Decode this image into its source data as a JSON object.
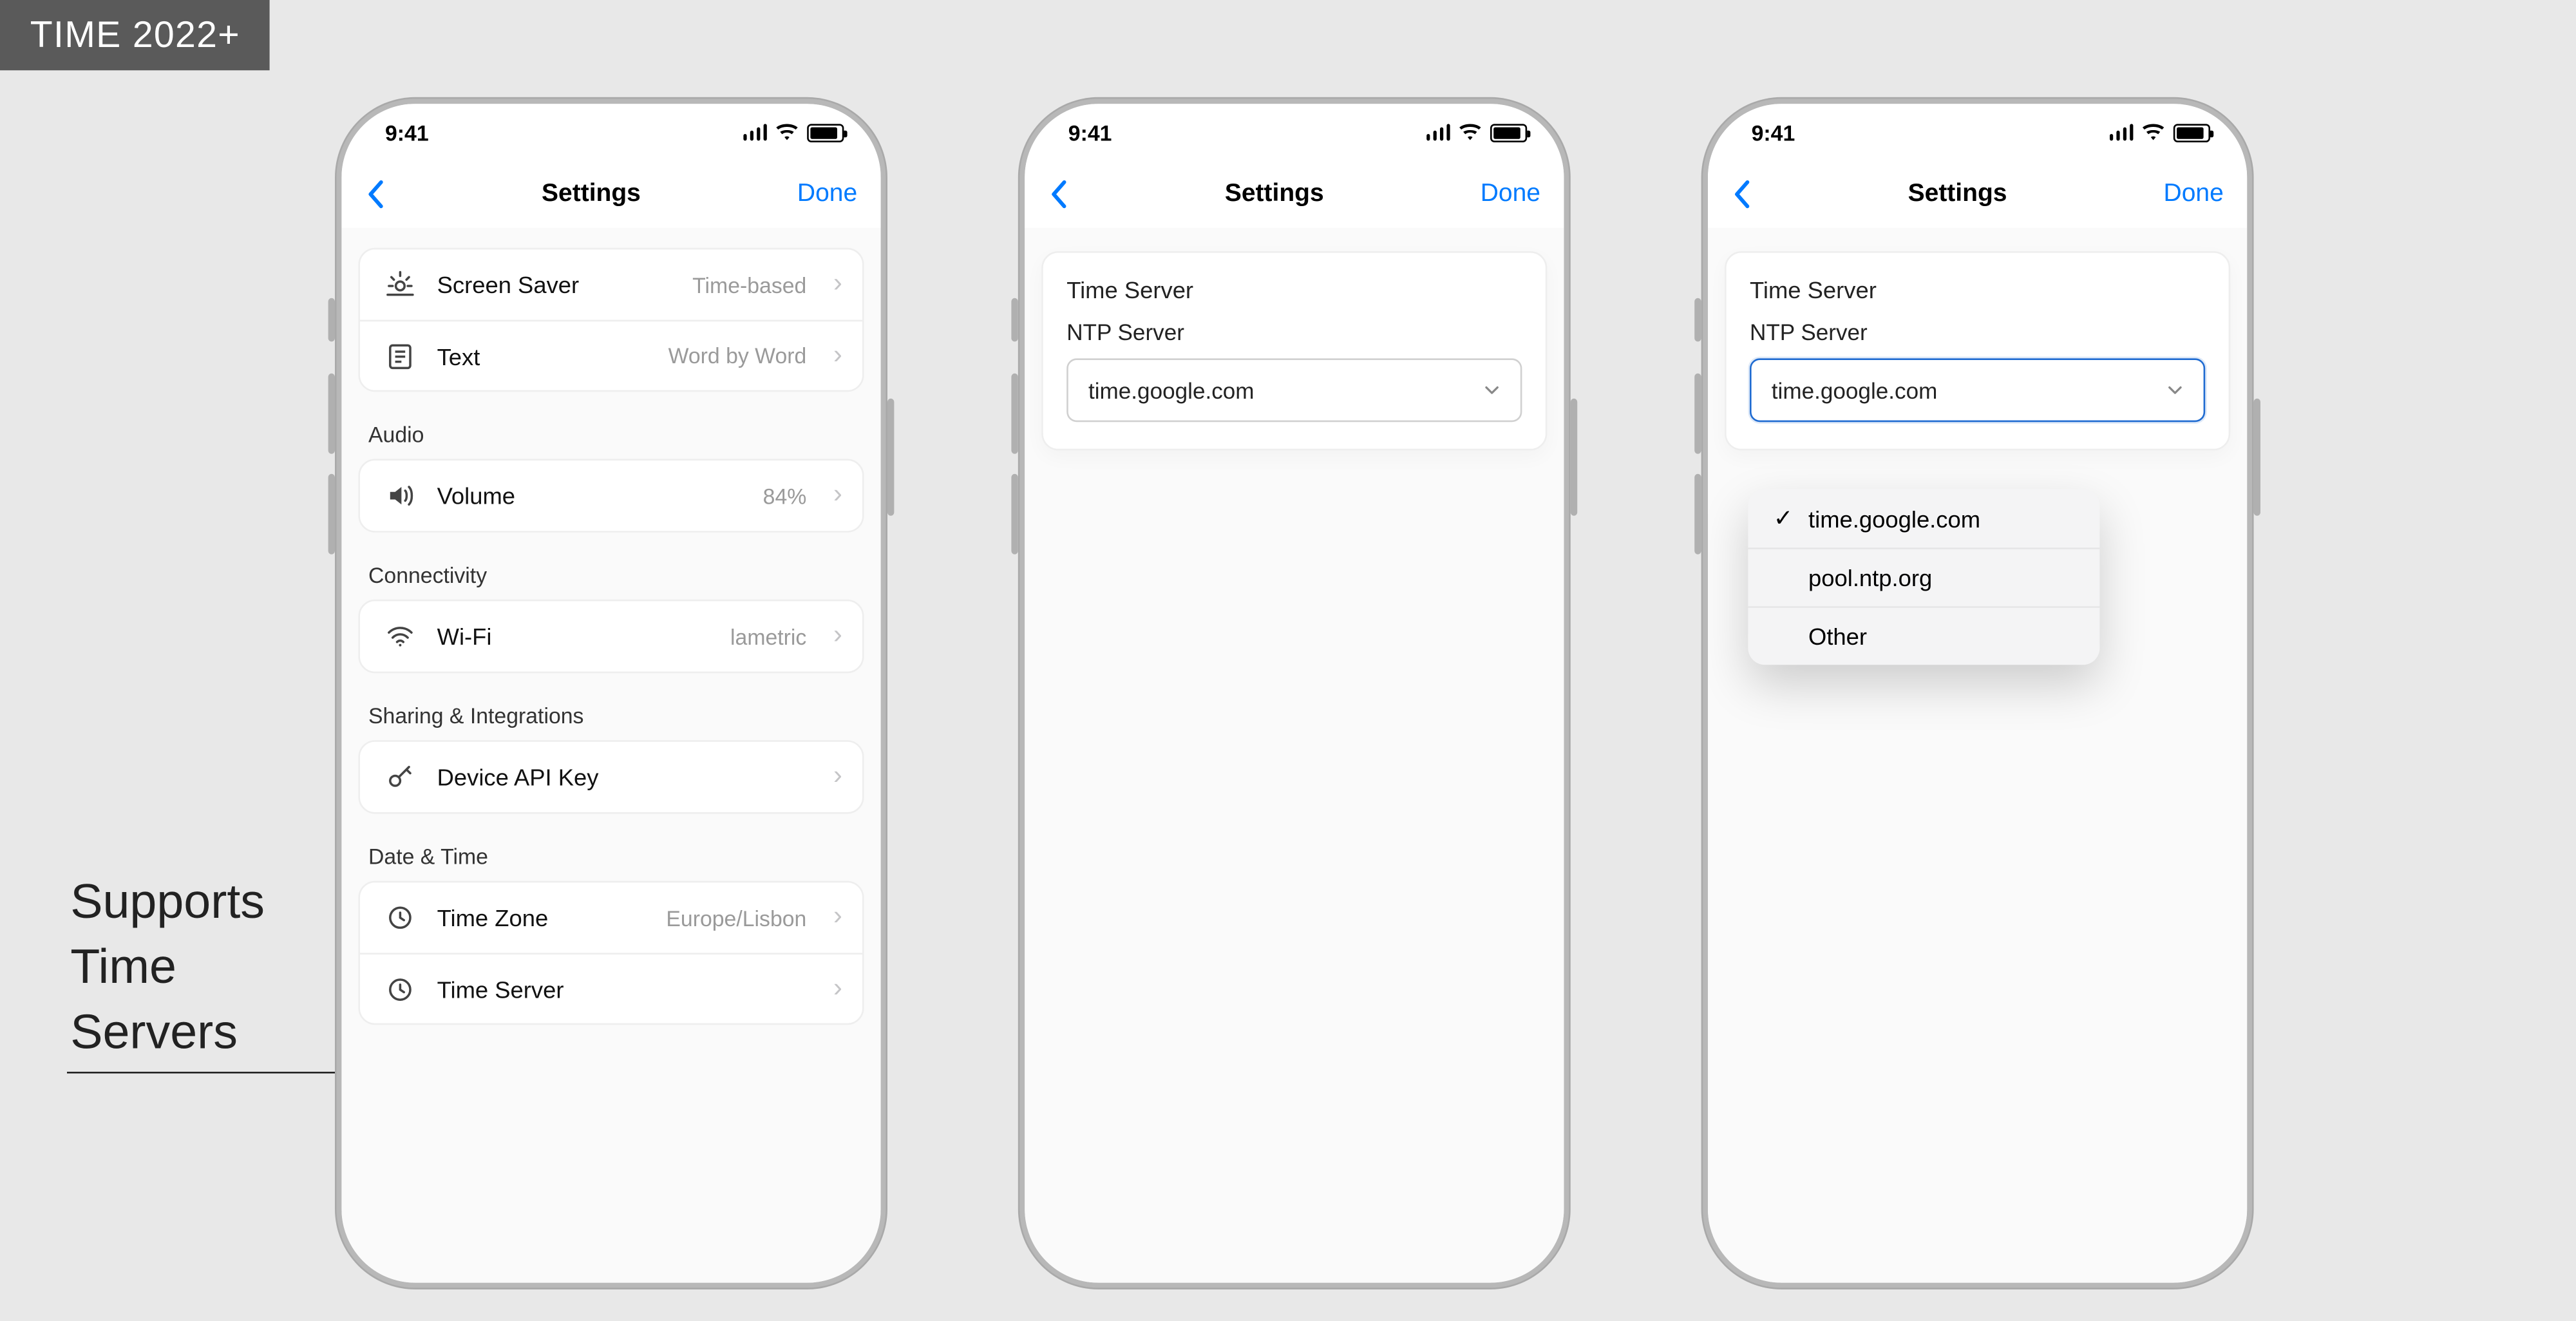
{
  "badge": "TIME 2022+",
  "callout_lines": [
    "Supports",
    "Time",
    "Servers"
  ],
  "status": {
    "time": "9:41"
  },
  "nav": {
    "title": "Settings",
    "done": "Done"
  },
  "screen1": {
    "rows_top": [
      {
        "icon": "screensaver",
        "label": "Screen Saver",
        "value": "Time-based"
      },
      {
        "icon": "text",
        "label": "Text",
        "value": "Word by Word"
      }
    ],
    "audio_header": "Audio",
    "audio_rows": [
      {
        "icon": "volume",
        "label": "Volume",
        "value": "84%"
      }
    ],
    "connectivity_header": "Connectivity",
    "connectivity_rows": [
      {
        "icon": "wifi",
        "label": "Wi-Fi",
        "value": "lametric"
      }
    ],
    "sharing_header": "Sharing & Integrations",
    "sharing_rows": [
      {
        "icon": "key",
        "label": "Device API Key",
        "value": ""
      }
    ],
    "datetime_header": "Date & Time",
    "datetime_rows": [
      {
        "icon": "clock",
        "label": "Time Zone",
        "value": "Europe/Lisbon"
      },
      {
        "icon": "clock",
        "label": "Time Server",
        "value": ""
      }
    ]
  },
  "screen2": {
    "card_title": "Time Server",
    "field_label": "NTP Server",
    "field_value": "time.google.com"
  },
  "screen3": {
    "card_title": "Time Server",
    "field_label": "NTP Server",
    "field_value": "time.google.com",
    "options": [
      {
        "label": "time.google.com",
        "selected": true
      },
      {
        "label": "pool.ntp.org",
        "selected": false
      },
      {
        "label": "Other",
        "selected": false
      }
    ]
  }
}
